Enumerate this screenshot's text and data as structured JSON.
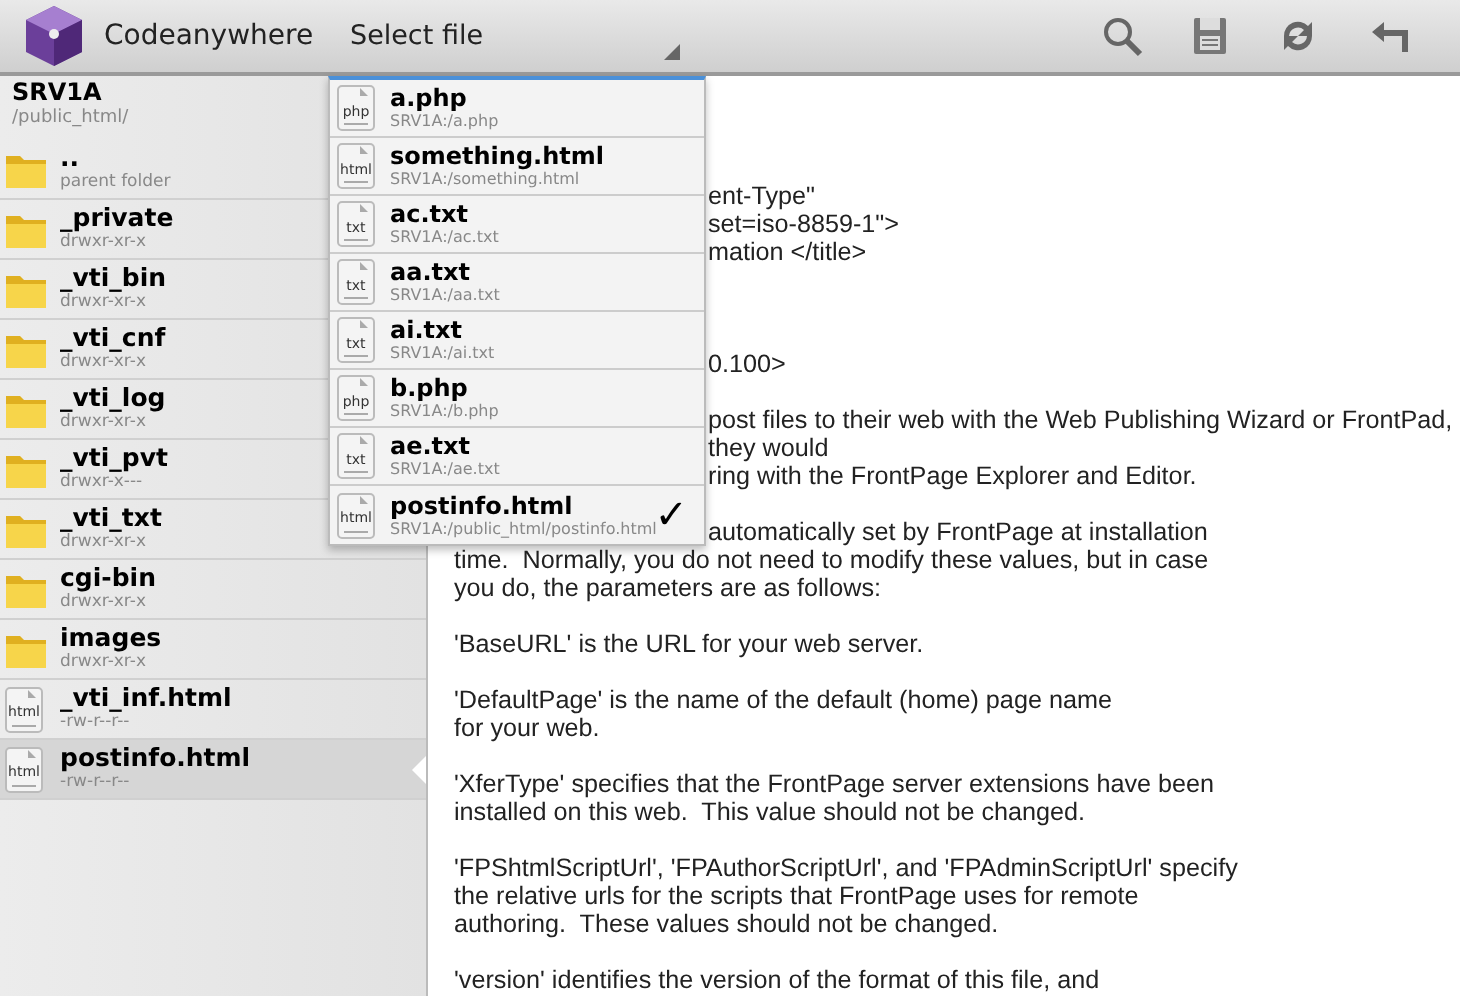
{
  "app": {
    "title": "Codeanywhere"
  },
  "file_selector": {
    "label": "Select file",
    "expanded": true
  },
  "toolbar": [
    {
      "kind": "search"
    },
    {
      "kind": "save"
    },
    {
      "kind": "refresh"
    },
    {
      "kind": "undo"
    }
  ],
  "sidebar": {
    "server": "SRV1A",
    "path": "/public_html/",
    "items": [
      {
        "kind": "folder",
        "name": "..",
        "detail": "parent folder",
        "current": false
      },
      {
        "kind": "folder",
        "name": "_private",
        "detail": "drwxr-xr-x",
        "current": false
      },
      {
        "kind": "folder",
        "name": "_vti_bin",
        "detail": "drwxr-xr-x",
        "current": false
      },
      {
        "kind": "folder",
        "name": "_vti_cnf",
        "detail": "drwxr-xr-x",
        "current": false
      },
      {
        "kind": "folder",
        "name": "_vti_log",
        "detail": "drwxr-xr-x",
        "current": false
      },
      {
        "kind": "folder",
        "name": "_vti_pvt",
        "detail": "drwxr-x---",
        "current": false
      },
      {
        "kind": "folder",
        "name": "_vti_txt",
        "detail": "drwxr-xr-x",
        "current": false
      },
      {
        "kind": "folder",
        "name": "cgi-bin",
        "detail": "drwxr-xr-x",
        "current": false
      },
      {
        "kind": "folder",
        "name": "images",
        "detail": "drwxr-xr-x",
        "current": false
      },
      {
        "kind": "file",
        "ext": "html",
        "name": "_vti_inf.html",
        "detail": "-rw-r--r--",
        "current": false
      },
      {
        "kind": "file",
        "ext": "html",
        "name": "postinfo.html",
        "detail": "-rw-r--r--",
        "current": true
      }
    ]
  },
  "open_files": [
    {
      "ext": "php",
      "name": "a.php",
      "path": "SRV1A:/a.php",
      "selected": false
    },
    {
      "ext": "html",
      "name": "something.html",
      "path": "SRV1A:/something.html",
      "selected": false
    },
    {
      "ext": "txt",
      "name": "ac.txt",
      "path": "SRV1A:/ac.txt",
      "selected": false
    },
    {
      "ext": "txt",
      "name": "aa.txt",
      "path": "SRV1A:/aa.txt",
      "selected": false
    },
    {
      "ext": "txt",
      "name": "ai.txt",
      "path": "SRV1A:/ai.txt",
      "selected": false
    },
    {
      "ext": "php",
      "name": "b.php",
      "path": "SRV1A:/b.php",
      "selected": false
    },
    {
      "ext": "txt",
      "name": "ae.txt",
      "path": "SRV1A:/ae.txt",
      "selected": false
    },
    {
      "ext": "html",
      "name": "postinfo.html",
      "path": "SRV1A:/public_html/postinfo.html",
      "selected": true
    }
  ],
  "check_mark": "✓",
  "editor": {
    "lines": [
      {
        "text": "ent-Type\"",
        "kind": "clipped"
      },
      {
        "text": "set=iso-8859-1\">",
        "kind": "clipped"
      },
      {
        "text": "mation </title>",
        "kind": "clipped"
      },
      {
        "kind": "hidden"
      },
      {
        "kind": "blank"
      },
      {
        "kind": "hidden"
      },
      {
        "text": "0.100>",
        "kind": "clipped"
      },
      {
        "kind": "hidden"
      },
      {
        "text": "post files to their web with the Web Publishing Wizard or FrontPad,",
        "kind": "clipped"
      },
      {
        "text": "they would",
        "kind": "clipped"
      },
      {
        "text": "ring with the FrontPage Explorer and Editor.",
        "kind": "clipped"
      },
      {
        "kind": "blank"
      },
      {
        "text": "automatically set by FrontPage at installation",
        "kind": "clipped"
      },
      {
        "text": "time.  Normally, you do not need to modify these values, but in case",
        "kind": "full"
      },
      {
        "text": "you do, the parameters are as follows:",
        "kind": "full"
      },
      {
        "kind": "blank"
      },
      {
        "text": "'BaseURL' is the URL for your web server.",
        "kind": "full"
      },
      {
        "kind": "blank"
      },
      {
        "text": "'DefaultPage' is the name of the default (home) page name",
        "kind": "full"
      },
      {
        "text": "for your web.",
        "kind": "full"
      },
      {
        "kind": "blank"
      },
      {
        "text": "'XferType' specifies that the FrontPage server extensions have been",
        "kind": "full"
      },
      {
        "text": "installed on this web.  This value should not be changed.",
        "kind": "full"
      },
      {
        "kind": "blank"
      },
      {
        "text": "'FPShtmlScriptUrl', 'FPAuthorScriptUrl', and 'FPAdminScriptUrl' specify",
        "kind": "full"
      },
      {
        "text": "the relative urls for the scripts that FrontPage uses for remote",
        "kind": "full"
      },
      {
        "text": "authoring.  These values should not be changed.",
        "kind": "full"
      },
      {
        "kind": "blank"
      },
      {
        "text": "'version' identifies the version of the format of this file, and",
        "kind": "full"
      }
    ]
  }
}
